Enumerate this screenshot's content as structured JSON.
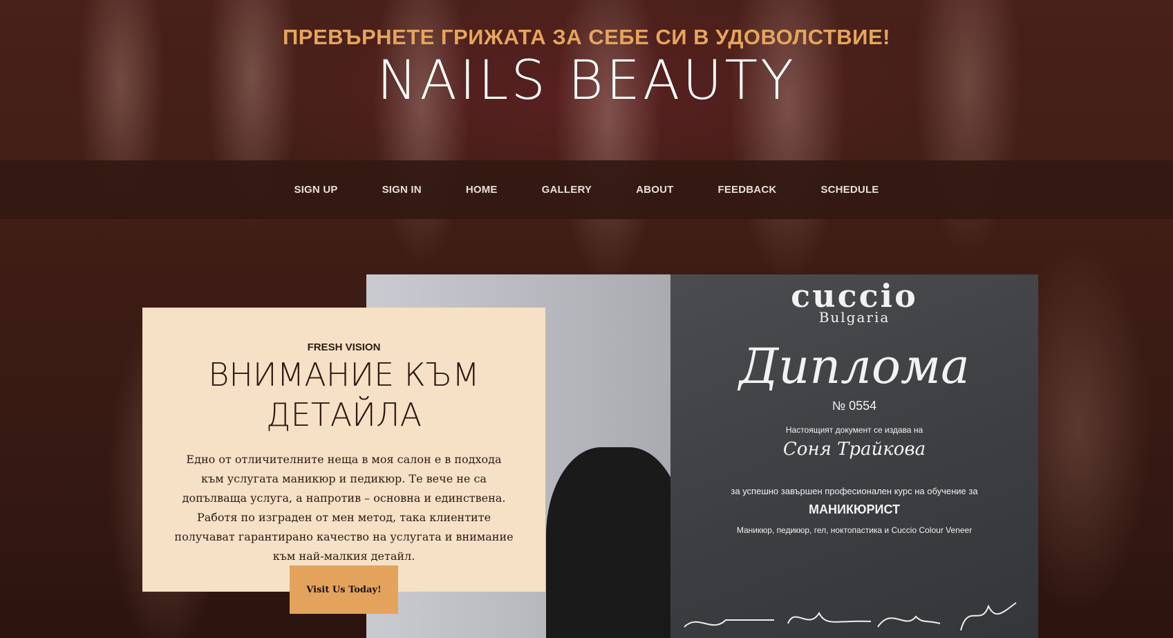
{
  "header": {
    "tagline": "ПРЕВЪРНЕТЕ ГРИЖАТА ЗА СЕБЕ СИ В УДОВОЛСТВИЕ!",
    "brand": "NAILS BEAUTY",
    "tagline_color": "#e6a55c"
  },
  "nav": {
    "items": [
      {
        "label": "SIGN UP"
      },
      {
        "label": "SIGN IN"
      },
      {
        "label": "HOME"
      },
      {
        "label": "GALLERY"
      },
      {
        "label": "ABOUT"
      },
      {
        "label": "FEEDBACK"
      },
      {
        "label": "SCHEDULE"
      }
    ]
  },
  "card": {
    "eyebrow": "FRESH VISION",
    "title": "ВНИМАНИЕ КЪМ ДЕТАЙЛА",
    "text": "Едно от отличителните неща в моя салон е в подхода към услугата маникюр и педикюр. Те вече не са допълваща услуга, а напротив – основна и единствена. Работя по изграден от мен метод, така клиентите получават гарантирано качество на услугата и внимание към най-малкия детайл.",
    "button_label": "Visit Us Today!",
    "background": "#f6e1c7",
    "button_color": "#e4a35c"
  },
  "diploma": {
    "logo": "cuccio",
    "subtitle": "Bulgaria",
    "title": "Диплома",
    "number": "№ 0554",
    "issued": "Настоящият документ се издава на",
    "name": "Соня Трайкова",
    "course": "за успешно завършен професионален курс на обучение за",
    "role": "МАНИКЮРИСТ",
    "desc": "Маникюр, педикюр, гел, ноктопастика и Cuccio Colour Veneer"
  }
}
